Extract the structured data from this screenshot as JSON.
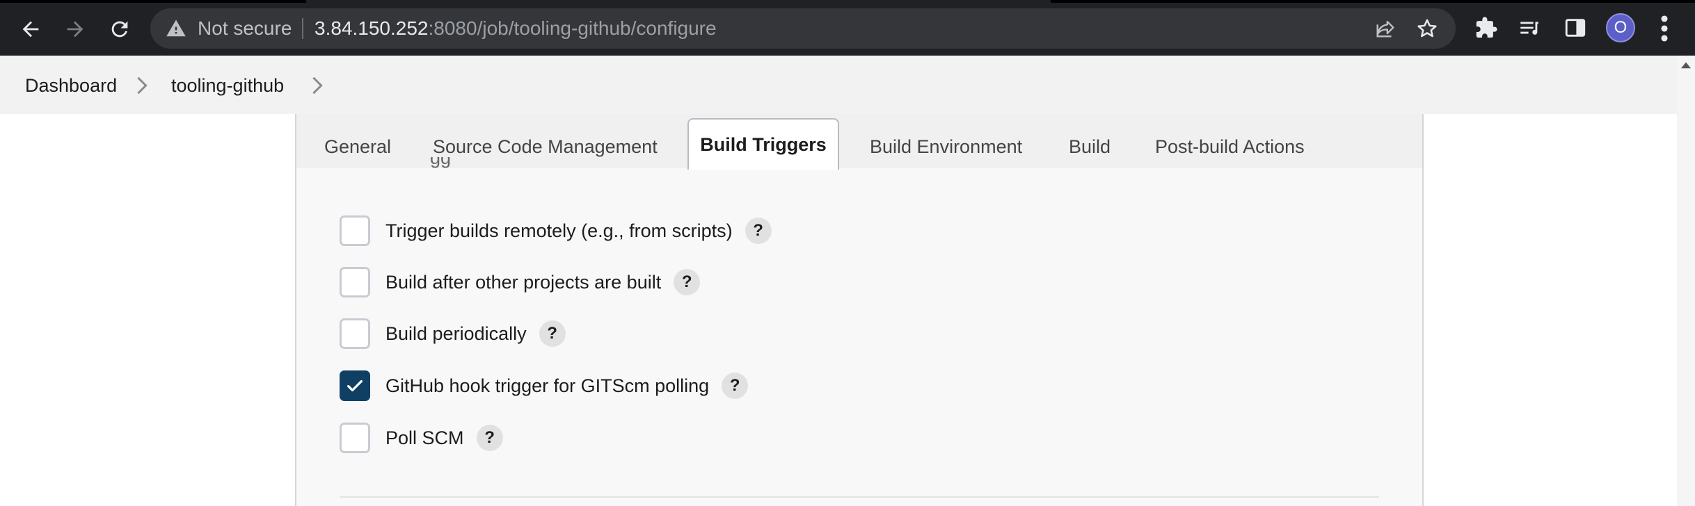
{
  "browser": {
    "security_label": "Not secure",
    "url_host": "3.84.150.252",
    "url_rest": ":8080/job/tooling-github/configure",
    "profile_initial": "O",
    "icons": [
      "back-icon",
      "forward-icon",
      "reload-icon",
      "warning-icon",
      "share-icon",
      "star-icon",
      "extensions-icon",
      "reading-list-icon",
      "side-panel-icon",
      "more-icon"
    ]
  },
  "breadcrumb": {
    "items": [
      "Dashboard",
      "tooling-github"
    ]
  },
  "tabs": {
    "items": [
      "General",
      "Source Code Management",
      "Build Triggers",
      "Build Environment",
      "Build",
      "Post-build Actions"
    ],
    "active": "Build Triggers"
  },
  "build_triggers": {
    "options": [
      {
        "label": "Trigger builds remotely (e.g., from scripts)",
        "checked": false
      },
      {
        "label": "Build after other projects are built",
        "checked": false
      },
      {
        "label": "Build periodically",
        "checked": false
      },
      {
        "label": "GitHub hook trigger for GITScm polling",
        "checked": true
      },
      {
        "label": "Poll SCM",
        "checked": false
      }
    ],
    "help_glyph": "?"
  },
  "colors": {
    "chrome_bg": "#202124",
    "checkbox_checked": "#0f4064",
    "panel_bg": "#f8f8f8"
  }
}
